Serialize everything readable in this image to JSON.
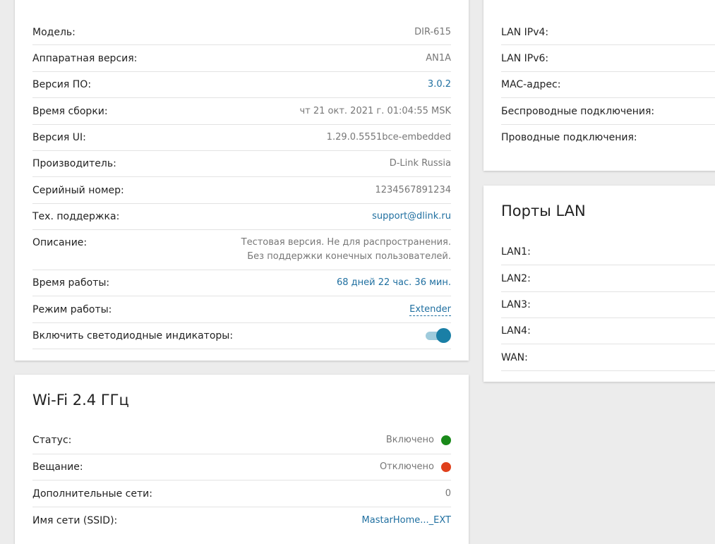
{
  "device": {
    "rows": [
      {
        "label": "Модель:",
        "value": "DIR-615"
      },
      {
        "label": "Аппаратная версия:",
        "value": "AN1A"
      },
      {
        "label": "Версия ПО:",
        "value": "3.0.2"
      },
      {
        "label": "Время сборки:",
        "value": "чт 21 окт. 2021 г. 01:04:55 MSK"
      },
      {
        "label": "Версия UI:",
        "value": "1.29.0.5551bce-embedded"
      },
      {
        "label": "Производитель:",
        "value": "D-Link Russia"
      },
      {
        "label": "Серийный номер:",
        "value": "1234567891234"
      },
      {
        "label": "Тех. поддержка:",
        "value": "support@dlink.ru"
      },
      {
        "label": "Описание:",
        "value": "Тестовая версия. Не для распространения. Без поддержки конечных пользователей."
      },
      {
        "label": "Время работы:",
        "value": "68 дней 22 час. 36 мин."
      },
      {
        "label": "Режим работы:",
        "value": "Extender"
      },
      {
        "label": "Включить светодиодные индикаторы:",
        "value": ""
      }
    ],
    "led_toggle_on": true
  },
  "wifi": {
    "title": "Wi-Fi 2.4 ГГц",
    "rows": [
      {
        "label": "Статус:",
        "value": "Включено",
        "color": "#1a8a1a"
      },
      {
        "label": "Вещание:",
        "value": "Отключено",
        "color": "#e0401c"
      },
      {
        "label": "Дополнительные сети:",
        "value": "0"
      },
      {
        "label": "Имя сети (SSID):",
        "value": "MastarHome..._EXT"
      }
    ]
  },
  "network": {
    "rows": [
      {
        "label": "LAN IPv4:"
      },
      {
        "label": "LAN IPv6:"
      },
      {
        "label": "MAC-адрес:"
      },
      {
        "label": "Беспроводные подключения:"
      },
      {
        "label": "Проводные подключения:"
      }
    ]
  },
  "lan_ports": {
    "title": "Порты LAN",
    "rows": [
      {
        "label": "LAN1:"
      },
      {
        "label": "LAN2:"
      },
      {
        "label": "LAN3:"
      },
      {
        "label": "LAN4:"
      },
      {
        "label": "WAN:"
      }
    ]
  }
}
